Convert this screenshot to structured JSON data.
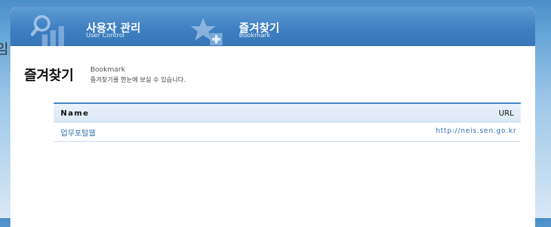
{
  "edge_glyph": "임",
  "tabs": [
    {
      "title": "사용자 관리",
      "subtitle": "User Control",
      "icon": "search-chart-icon"
    },
    {
      "title": "즐겨찾기",
      "subtitle": "Bookmark",
      "icon": "star-add-icon"
    }
  ],
  "page": {
    "title": "즐겨찾기",
    "subtitle_en": "Bookmark",
    "description": "즐겨찾기를 한눈에 보실 수 있습니다."
  },
  "table": {
    "headers": {
      "name": "Name",
      "url": "URL"
    },
    "rows": [
      {
        "name": "업무포털웹",
        "url": "http://neis.sen.go.kr"
      }
    ]
  },
  "colors": {
    "header_blue": "#3f80c2",
    "link_blue": "#2f6fb3",
    "table_accent": "#3b79c0"
  }
}
